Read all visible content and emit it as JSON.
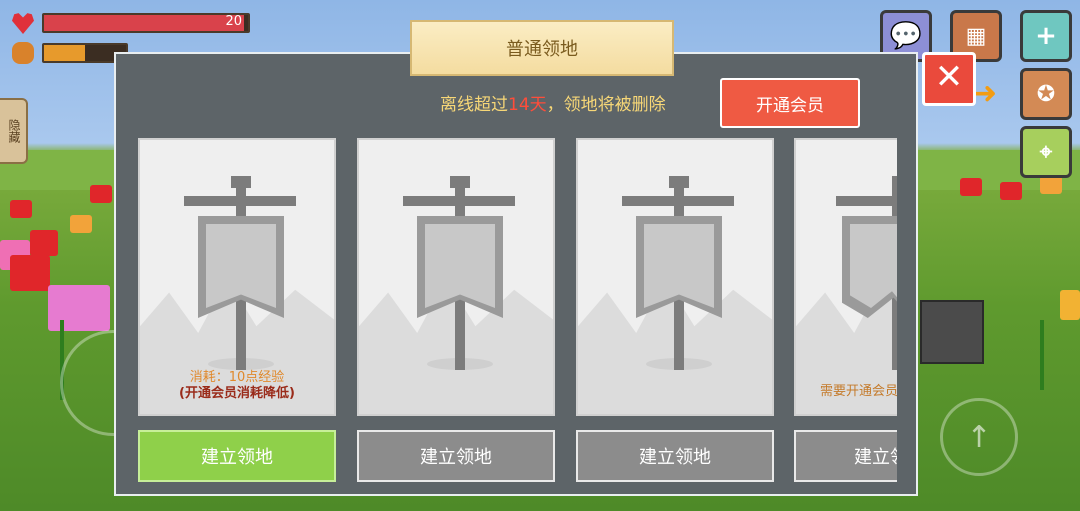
{
  "hud": {
    "health_value": "20",
    "health_fill": 0.98,
    "hunger_fill": 0.5,
    "hide_tab_label": "隐藏"
  },
  "dialog": {
    "title": "普通领地",
    "notice_prefix": "离线超过",
    "notice_days": "14天",
    "notice_suffix": "，领地将被删除",
    "vip_button": "开通会员",
    "close_label": "✕"
  },
  "cards": [
    {
      "cost_line1": "消耗：10点经验",
      "cost_line2": "(开通会员消耗降低)",
      "button": "建立领地",
      "state": "active"
    },
    {
      "cost_line1": "",
      "cost_line2": "",
      "button": "建立领地",
      "state": "disabled"
    },
    {
      "cost_line1": "",
      "cost_line2": "",
      "button": "建立领地",
      "state": "disabled"
    },
    {
      "vip_needed": "需要开通会员",
      "button": "建立领地",
      "state": "disabled"
    }
  ],
  "colors": {
    "accent_red": "#ef5a43",
    "active_green": "#8fd04a",
    "disabled_gray": "#8c8c8c",
    "days_red": "#ff4d3a"
  },
  "icons": [
    "heart-icon",
    "hunger-icon",
    "chat-icon",
    "shop-icon",
    "plus-icon",
    "achievement-icon",
    "location-icon",
    "arrow-right-icon",
    "close-icon",
    "banner-flag-icon",
    "jump-arrow-icon"
  ]
}
